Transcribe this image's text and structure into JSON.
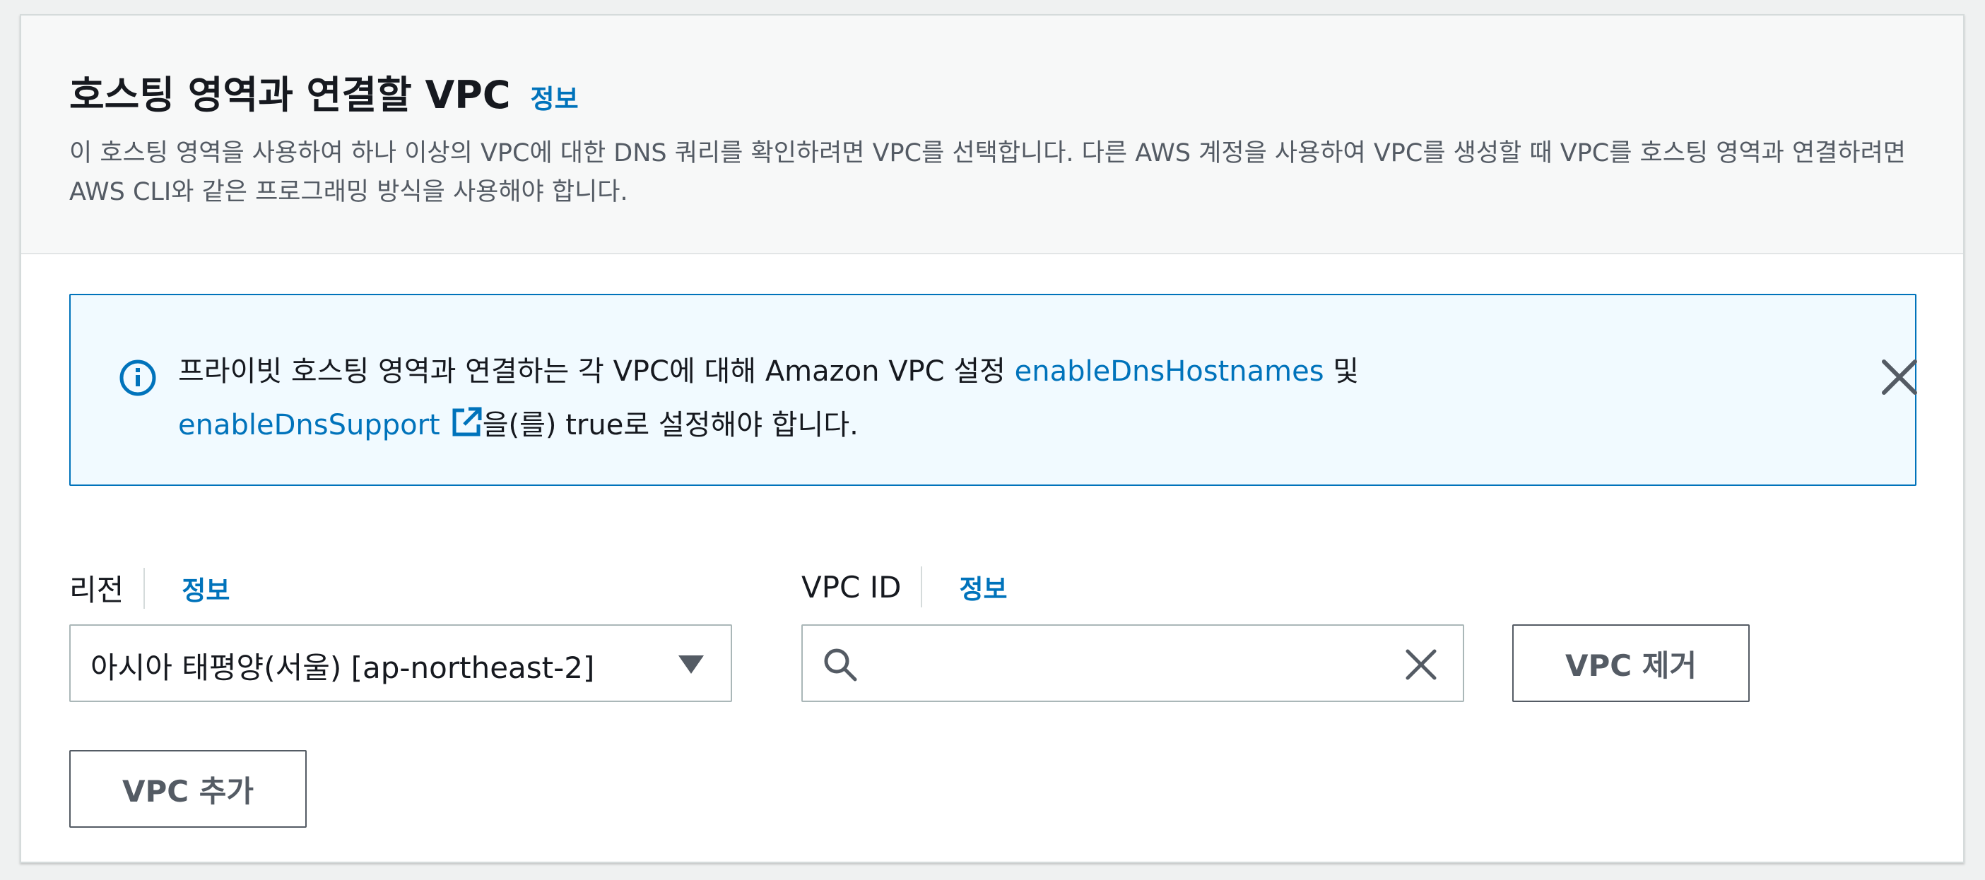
{
  "header": {
    "title": "호스팅 영역과 연결할 VPC",
    "info_label": "정보",
    "description": "이 호스팅 영역을 사용하여 하나 이상의 VPC에 대한 DNS 쿼리를 확인하려면 VPC를 선택합니다. 다른 AWS 계정을 사용하여 VPC를 생성할 때 VPC를 호스팅 영역과 연결하려면 AWS CLI와 같은 프로그래밍 방식을 사용해야 합니다."
  },
  "alert": {
    "text_before": "프라이빗 호스팅 영역과 연결하는 각 VPC에 대해 Amazon VPC 설정 ",
    "link1": "enableDnsHostnames",
    "text_middle": " 및 ",
    "link2": "enableDnsSupport",
    "text_after": "을(를) true로 설정해야 합니다.",
    "icon": "info-circle-icon",
    "close_icon": "close-icon"
  },
  "region": {
    "label": "리전",
    "info_label": "정보",
    "value": "아시아 태평양(서울) [ap-northeast-2]"
  },
  "vpc": {
    "label": "VPC ID",
    "info_label": "정보",
    "value": ""
  },
  "buttons": {
    "remove_vpc": "VPC 제거",
    "add_vpc": "VPC 추가"
  },
  "colors": {
    "link": "#0073bb",
    "alert_background": "#f1faff",
    "alert_border": "#0073bb",
    "button_text": "#545b64"
  }
}
